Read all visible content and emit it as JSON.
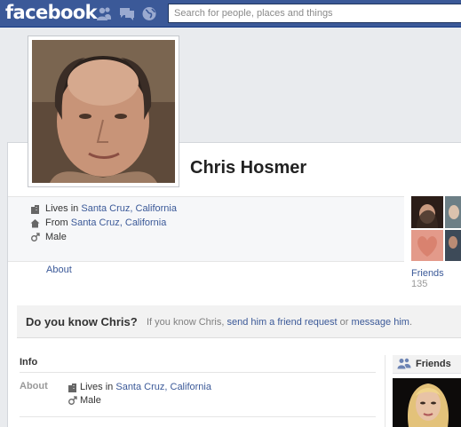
{
  "header": {
    "logo_text": "facebook",
    "search_placeholder": "Search for people, places and things",
    "icons": [
      "friend-requests-icon",
      "messages-icon",
      "notifications-globe-icon"
    ]
  },
  "profile": {
    "name": "Chris Hosmer",
    "lives_in_prefix": "Lives in",
    "lives_in_place": "Santa Cruz, California",
    "from_prefix": "From",
    "from_place": "Santa Cruz, California",
    "gender": "Male",
    "about_link": "About",
    "friends_label": "Friends",
    "friends_count": "135"
  },
  "know_bar": {
    "title": "Do you know Chris?",
    "text_1": "If you know Chris, ",
    "link_request": "send him a friend request",
    "text_2": " or ",
    "link_message": "message him",
    "text_3": "."
  },
  "info_section": {
    "header": "Info",
    "about_label": "About",
    "lives_in_prefix": "Lives in",
    "lives_in_place": "Santa Cruz, California",
    "gender": "Male"
  },
  "friends_box": {
    "title": "Friends"
  },
  "colors": {
    "brand_blue": "#3b5998",
    "page_bg": "#e9ebee",
    "link": "#3b5998"
  }
}
